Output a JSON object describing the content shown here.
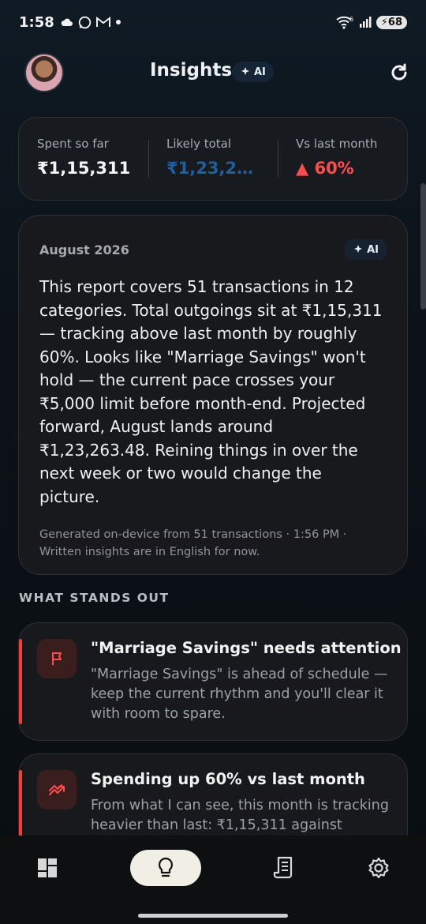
{
  "status_bar": {
    "time": "1:58",
    "left_icons": [
      "cloud-icon",
      "whatsapp-icon",
      "gmail-icon",
      "dot-icon"
    ],
    "wifi_label": "6",
    "battery": "68"
  },
  "header": {
    "title": "Insights",
    "ai_badge": "AI"
  },
  "stats": [
    {
      "label": "Spent so far",
      "value": "₹1,15,311",
      "color": "#f4f4f4"
    },
    {
      "label": "Likely total",
      "value": "₹1,23,263...",
      "color": "#1f5f9e"
    },
    {
      "label": "Vs last month",
      "value": "▲ 60%",
      "color": "#ff4d4d"
    }
  ],
  "report": {
    "month": "August 2026",
    "ai_badge": "AI",
    "body": "This report covers 51 transactions in 12 categories. Total outgoings sit at ₹1,15,311 — tracking above last month by roughly 60%. Looks like \"Marriage Savings\" won't hold — the current pace crosses your ₹5,000 limit before month-end. Projected forward, August lands around ₹1,23,263.48. Reining things in over the next week or two would change the picture.",
    "footer": "Generated on-device from 51 transactions · 1:56 PM · Written insights are in English for now."
  },
  "section_label": "WHAT STANDS OUT",
  "insights": [
    {
      "icon": "flag-icon",
      "title": "\"Marriage Savings\" needs attention",
      "text": "\"Marriage Savings\" is ahead of schedule — keep the current rhythm and you'll clear it with room to spare."
    },
    {
      "icon": "trending-up-icon",
      "title": "Spending up 60% vs last month",
      "text": "From what I can see, this month is tracking heavier than last: ₹1,15,311 against"
    }
  ],
  "nav": [
    {
      "name": "dashboard",
      "icon": "dashboard-icon",
      "active": false
    },
    {
      "name": "insights",
      "icon": "lightbulb-icon",
      "active": true
    },
    {
      "name": "transactions",
      "icon": "receipt-icon",
      "active": false
    },
    {
      "name": "settings",
      "icon": "settings-icon",
      "active": false
    }
  ],
  "colors": {
    "accent_red": "#ff3b30",
    "likely_total_blue": "#1f5f9e",
    "nav_active_bg": "#f1eee6"
  }
}
